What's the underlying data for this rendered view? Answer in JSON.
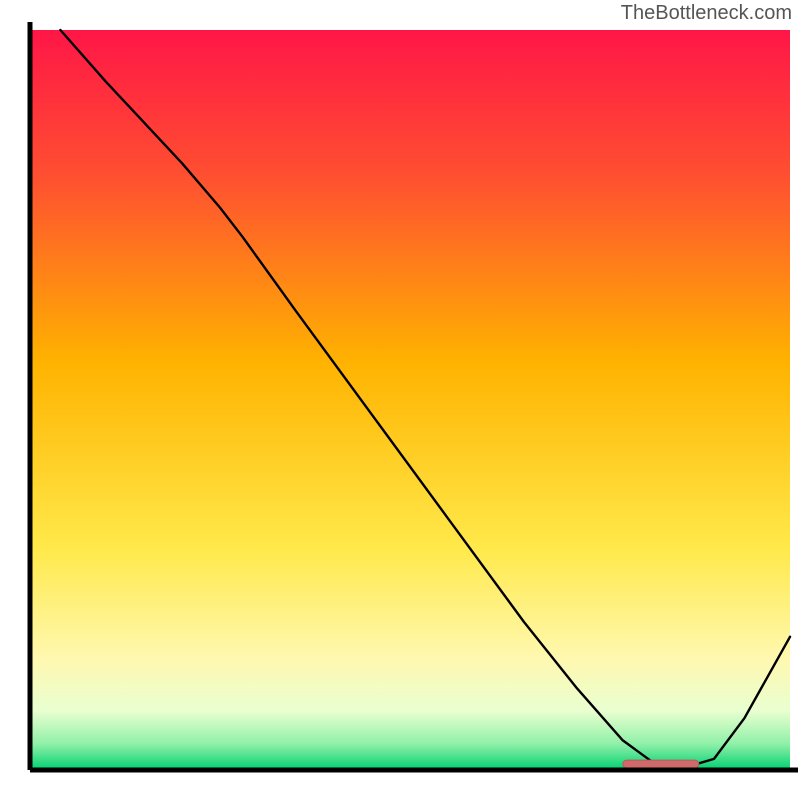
{
  "watermark": "TheBottleneck.com",
  "colors": {
    "axis": "#000000",
    "line": "#000000",
    "marker_fill": "#cf6a6a",
    "marker_stroke": "#b85a5a",
    "gradient": [
      {
        "offset": 0.0,
        "color": "#ff1647"
      },
      {
        "offset": 0.2,
        "color": "#ff5030"
      },
      {
        "offset": 0.45,
        "color": "#ffb300"
      },
      {
        "offset": 0.7,
        "color": "#ffe94a"
      },
      {
        "offset": 0.85,
        "color": "#fff8b0"
      },
      {
        "offset": 0.92,
        "color": "#e9ffd0"
      },
      {
        "offset": 0.965,
        "color": "#8ff0a8"
      },
      {
        "offset": 1.0,
        "color": "#00d070"
      }
    ]
  },
  "chart_data": {
    "type": "line",
    "title": "",
    "xlabel": "",
    "ylabel": "",
    "xlim": [
      0,
      100
    ],
    "ylim": [
      0,
      100
    ],
    "x": [
      4,
      10,
      20,
      25,
      28,
      35,
      45,
      55,
      65,
      72,
      78,
      82,
      86,
      90,
      94,
      100
    ],
    "y": [
      100,
      93,
      82,
      76,
      72,
      62,
      48,
      34,
      20,
      11,
      4,
      1,
      0.3,
      1.5,
      7,
      18
    ],
    "optimum_band_x": [
      78,
      88
    ],
    "optimum_band_y": 0.8
  }
}
